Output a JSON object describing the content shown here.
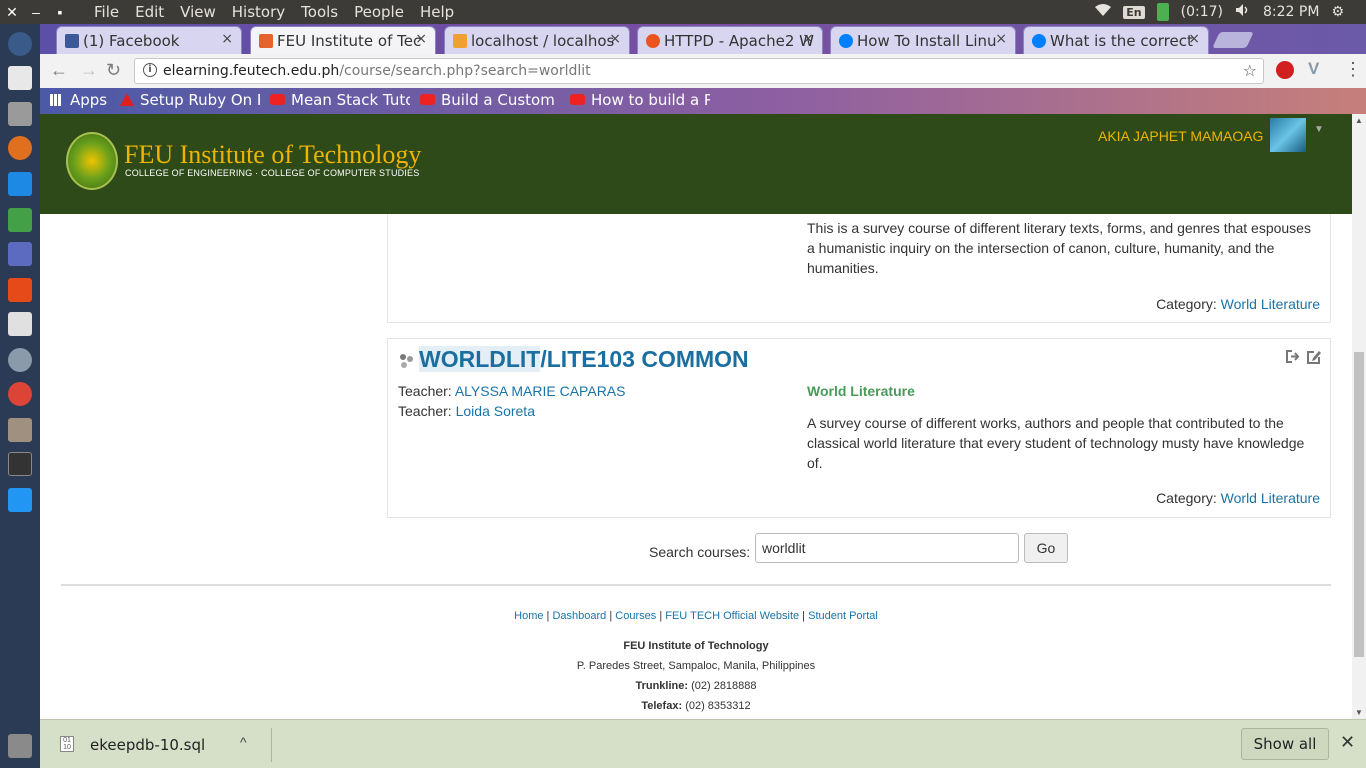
{
  "os": {
    "close_glyph": "✕",
    "minimize_glyph": "–",
    "menu": [
      "File",
      "Edit",
      "View",
      "History",
      "Tools",
      "People",
      "Help"
    ],
    "keyboard_layout": "En",
    "battery_time": "(0:17)",
    "clock": "8:22 PM"
  },
  "tabs": [
    {
      "label": "(1) Facebook",
      "icon_color": "#3b5998",
      "active": false
    },
    {
      "label": "FEU Institute of Tec",
      "icon_color": "#e5622d",
      "active": true
    },
    {
      "label": "localhost / localhos",
      "icon_color": "#f0a030",
      "active": false
    },
    {
      "label": "HTTPD - Apache2 W",
      "icon_color": "#e95420",
      "active": false
    },
    {
      "label": "How To Install Linu",
      "icon_color": "#0080ff",
      "active": false
    },
    {
      "label": "What is the correct",
      "icon_color": "#0080ff",
      "active": false
    }
  ],
  "tab_close_glyph": "×",
  "address": {
    "domain": "elearning.feutech.edu.ph",
    "path": "/course/search.php?search=worldlit",
    "info_glyph": "i",
    "star_glyph": "☆"
  },
  "bookmarks": [
    {
      "label": "Apps",
      "icon": "apps-grid-icon",
      "color": "#ffffff"
    },
    {
      "label": "Setup Ruby On R",
      "icon": "ruby-icon",
      "color": "#e02020"
    },
    {
      "label": "Mean Stack Tuto",
      "icon": "youtube-icon",
      "color": "#e02020"
    },
    {
      "label": "Build a Custom N",
      "icon": "youtube-icon",
      "color": "#e02020"
    },
    {
      "label": "How to build a Pi",
      "icon": "youtube-icon",
      "color": "#e02020"
    }
  ],
  "header": {
    "title": "FEU Institute of Technology",
    "subtitle": "COLLEGE OF ENGINEERING · COLLEGE OF COMPUTER STUDIES",
    "username": "AKIA JAPHET MAMAOAG",
    "brand_color": "#2d4a18",
    "accent_color": "#f0b400"
  },
  "course_prev": {
    "summary": "This is a survey course of different literary texts, forms, and genres that espouses a humanistic inquiry on the intersection of canon, culture, humanity, and the humanities.",
    "category_label": "Category:",
    "category_value": "World Literature"
  },
  "course_main": {
    "title_highlight": "WORLDLIT",
    "title_rest": "/LITE103 COMMON",
    "teachers": [
      {
        "label": "Teacher:",
        "name": "ALYSSA MARIE CAPARAS"
      },
      {
        "label": "Teacher:",
        "name": "Loida Soreta"
      }
    ],
    "category_name": "World Literature",
    "summary": "A survey course of different works, authors and people that contributed to the classical world literature that every student of technology musty have knowledge of.",
    "category_label": "Category:",
    "category_value": "World Literature"
  },
  "search": {
    "label": "Search courses:",
    "value": "worldlit",
    "button": "Go"
  },
  "footer": {
    "links": [
      "Home",
      "Dashboard",
      "Courses",
      "FEU TECH Official Website",
      "Student Portal"
    ],
    "org": "FEU Institute of Technology",
    "address": "P. Paredes Street, Sampaloc, Manila, Philippines",
    "trunkline_label": "Trunkline:",
    "trunkline": "(02) 2818888",
    "telefax_label": "Telefax:",
    "telefax": "(02) 8353312"
  },
  "download": {
    "file": "ekeepdb-10.sql",
    "file_icon_text": "01 10",
    "chevron_glyph": "^",
    "show_all": "Show all",
    "close_glyph": "✕"
  }
}
